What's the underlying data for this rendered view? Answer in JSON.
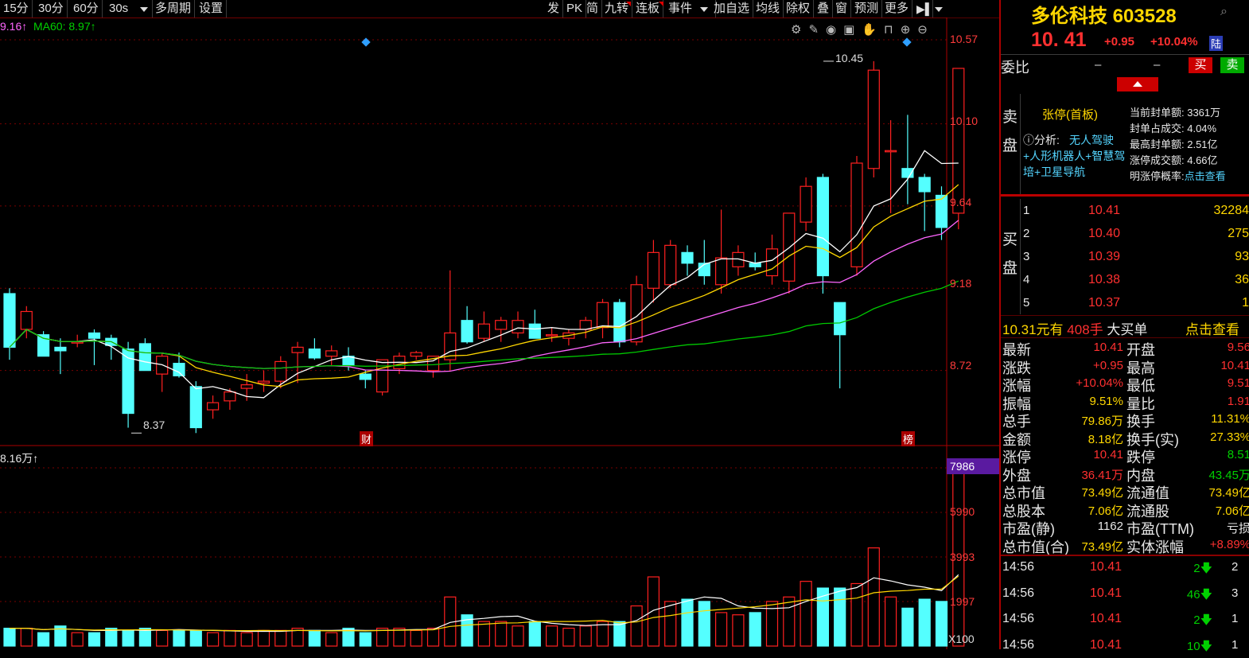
{
  "toolbar": {
    "left": [
      "15分",
      "30分",
      "60分",
      "30s",
      "多周期",
      "设置"
    ],
    "right": [
      "发",
      "PK",
      "简",
      "九转",
      "连板",
      "事件",
      "加自选",
      "均线",
      "除权",
      "叠",
      "窗",
      "预测",
      "更多"
    ]
  },
  "legend": {
    "ma_a": "9.16↑",
    "ma60": "MA60: 8.97↑",
    "vol": "8.16万↑"
  },
  "price_axis": [
    "10.57",
    "10.10",
    "9.64",
    "9.18",
    "8.72"
  ],
  "vol_axis": [
    "7986",
    "5990",
    "3993",
    "1997",
    "X100"
  ],
  "annotations": {
    "high": "10.45",
    "low": "8.37",
    "tag_cai": "财",
    "tag_bang": "榜"
  },
  "colors": {
    "up": "#ff2020",
    "down": "#54ffff",
    "ma5": "#ffffff",
    "ma10": "#ffd700",
    "ma20": "#ff66ff",
    "ma60": "#00c800",
    "panel_bg": "#000000"
  },
  "stock": {
    "name": "多伦科技",
    "code": "603528",
    "price": "10. 41",
    "change": "+0.95",
    "pct": "+10.04%",
    "market": "陆"
  },
  "order": {
    "label": "委比",
    "v1": "–",
    "v2": "–",
    "buy": "买",
    "sell": "卖"
  },
  "limit_info": {
    "title": "张停(首板)",
    "analysis_prefix": "分析:",
    "analysis": "无人驾驶+人形机器人+智慧驾培+卫星导航",
    "lines": [
      "当前封单额: 3361万",
      "封单占成交: 4.04%",
      "最高封单额: 2.51亿",
      "涨停成交额: 4.66亿"
    ],
    "prob_label": "明涨停概率:",
    "prob_link": "点击查看"
  },
  "side_labels": {
    "sell": "卖盘",
    "buy": "买盘"
  },
  "bids": [
    {
      "lvl": "1",
      "price": "10.41",
      "vol": "32284"
    },
    {
      "lvl": "2",
      "price": "10.40",
      "vol": "275"
    },
    {
      "lvl": "3",
      "price": "10.39",
      "vol": "93"
    },
    {
      "lvl": "4",
      "price": "10.38",
      "vol": "36"
    },
    {
      "lvl": "5",
      "price": "10.37",
      "vol": "1"
    }
  ],
  "bigbuy": {
    "price": "10.31元有",
    "qty": "408手",
    "label": "大买单",
    "link": "点击查看"
  },
  "stats": [
    {
      "l": "最新",
      "v": "10.41",
      "vc": "red",
      "l2": "开盘",
      "v2": "9.56",
      "v2c": "red"
    },
    {
      "l": "涨跌",
      "v": "+0.95",
      "vc": "red",
      "l2": "最高",
      "v2": "10.41",
      "v2c": "red"
    },
    {
      "l": "涨幅",
      "v": "+10.04%",
      "vc": "red",
      "l2": "最低",
      "v2": "9.51",
      "v2c": "red"
    },
    {
      "l": "振幅",
      "v": "9.51%",
      "vc": "yellow",
      "l2": "量比",
      "v2": "1.91",
      "v2c": "red"
    },
    {
      "l": "总手",
      "v": "79.86万",
      "vc": "yellow",
      "l2": "换手",
      "v2": "11.31%",
      "v2c": "yellow"
    },
    {
      "l": "金额",
      "v": "8.18亿",
      "vc": "yellow",
      "l2": "换手(实)",
      "v2": "27.33%",
      "v2c": "yellow"
    },
    {
      "l": "涨停",
      "v": "10.41",
      "vc": "red",
      "l2": "跌停",
      "v2": "8.51",
      "v2c": "green"
    },
    {
      "l": "外盘",
      "v": "36.41万",
      "vc": "red",
      "l2": "内盘",
      "v2": "43.45万",
      "v2c": "green"
    },
    {
      "l": "总市值",
      "v": "73.49亿",
      "vc": "yellow",
      "l2": "流通值",
      "v2": "73.49亿",
      "v2c": "yellow"
    },
    {
      "l": "总股本",
      "v": "7.06亿",
      "vc": "yellow",
      "l2": "流通股",
      "v2": "7.06亿",
      "v2c": "yellow"
    },
    {
      "l": "市盈(静)",
      "v": "1162",
      "vc": "white",
      "l2": "市盈(TTM)",
      "v2": "亏损",
      "v2c": "white"
    },
    {
      "l": "总市值(合)",
      "v": "73.49亿",
      "vc": "yellow",
      "l2": "实体涨幅",
      "v2": "+8.89%",
      "v2c": "red"
    }
  ],
  "ticks": [
    {
      "t": "14:56",
      "p": "10.41",
      "v": "2",
      "c": "2"
    },
    {
      "t": "14:56",
      "p": "10.41",
      "v": "46",
      "c": "3"
    },
    {
      "t": "14:56",
      "p": "10.41",
      "v": "2",
      "c": "1"
    },
    {
      "t": "14:56",
      "p": "10.41",
      "v": "10",
      "c": "1"
    }
  ],
  "chart_data": {
    "type": "candlestick",
    "ylim": [
      8.3,
      10.65
    ],
    "candles": [
      [
        9.15,
        9.18,
        8.78,
        8.85
      ],
      [
        8.95,
        9.08,
        8.9,
        9.05
      ],
      [
        8.92,
        8.94,
        8.8,
        8.8
      ],
      [
        8.85,
        8.9,
        8.7,
        8.83
      ],
      [
        8.88,
        8.92,
        8.85,
        8.88
      ],
      [
        8.93,
        8.95,
        8.75,
        8.9
      ],
      [
        8.9,
        8.92,
        8.78,
        8.86
      ],
      [
        8.84,
        8.88,
        8.4,
        8.48
      ],
      [
        8.87,
        8.9,
        8.72,
        8.72
      ],
      [
        8.7,
        8.82,
        8.6,
        8.8
      ],
      [
        8.76,
        8.82,
        8.68,
        8.69
      ],
      [
        8.63,
        8.66,
        8.37,
        8.4
      ],
      [
        8.5,
        8.58,
        8.45,
        8.54
      ],
      [
        8.55,
        8.62,
        8.5,
        8.6
      ],
      [
        8.62,
        8.7,
        8.55,
        8.64
      ],
      [
        8.65,
        8.72,
        8.6,
        8.66
      ],
      [
        8.66,
        8.8,
        8.62,
        8.77
      ],
      [
        8.82,
        8.88,
        8.65,
        8.85
      ],
      [
        8.84,
        8.9,
        8.78,
        8.79
      ],
      [
        8.8,
        8.86,
        8.75,
        8.83
      ],
      [
        8.8,
        8.85,
        8.72,
        8.75
      ],
      [
        8.7,
        8.72,
        8.62,
        8.67
      ],
      [
        8.6,
        8.78,
        8.58,
        8.78
      ],
      [
        8.73,
        8.82,
        8.7,
        8.8
      ],
      [
        8.8,
        8.83,
        8.78,
        8.82
      ],
      [
        8.72,
        8.8,
        8.68,
        8.8
      ],
      [
        8.78,
        9.28,
        8.72,
        8.93
      ],
      [
        9.0,
        9.08,
        8.87,
        8.88
      ],
      [
        8.9,
        9.05,
        8.88,
        8.98
      ],
      [
        8.95,
        9.02,
        8.88,
        9.0
      ],
      [
        8.93,
        9.05,
        8.9,
        9.0
      ],
      [
        8.98,
        9.06,
        8.92,
        8.9
      ],
      [
        8.92,
        8.96,
        8.88,
        8.92
      ],
      [
        8.9,
        8.95,
        8.86,
        8.93
      ],
      [
        8.95,
        9.02,
        8.9,
        9.0
      ],
      [
        8.96,
        9.12,
        8.9,
        9.1
      ],
      [
        9.1,
        9.12,
        8.85,
        8.88
      ],
      [
        8.88,
        9.25,
        8.86,
        9.2
      ],
      [
        9.18,
        9.45,
        9.1,
        9.38
      ],
      [
        9.2,
        9.45,
        9.18,
        9.42
      ],
      [
        9.38,
        9.42,
        9.25,
        9.32
      ],
      [
        9.32,
        9.45,
        9.2,
        9.25
      ],
      [
        9.2,
        9.62,
        9.15,
        9.35
      ],
      [
        9.3,
        9.42,
        9.25,
        9.38
      ],
      [
        9.32,
        9.38,
        9.28,
        9.3
      ],
      [
        9.25,
        9.48,
        9.2,
        9.4
      ],
      [
        9.22,
        9.55,
        9.15,
        9.6
      ],
      [
        9.55,
        9.8,
        9.5,
        9.75
      ],
      [
        9.8,
        9.82,
        9.15,
        9.25
      ],
      [
        9.1,
        9.0,
        8.62,
        8.92
      ],
      [
        9.3,
        9.92,
        9.25,
        9.88
      ],
      [
        9.85,
        10.45,
        9.8,
        10.4
      ],
      [
        9.95,
        10.12,
        9.6,
        9.95
      ],
      [
        9.85,
        10.15,
        9.65,
        9.8
      ],
      [
        9.8,
        9.82,
        9.5,
        9.72
      ],
      [
        9.7,
        9.75,
        9.45,
        9.52
      ],
      [
        9.6,
        10.41,
        9.51,
        10.41
      ]
    ],
    "vol_ylim": [
      0,
      8200
    ],
    "volume_x100": [
      800,
      800,
      600,
      900,
      600,
      600,
      800,
      700,
      800,
      700,
      700,
      700,
      600,
      700,
      600,
      700,
      700,
      800,
      700,
      600,
      800,
      600,
      800,
      800,
      700,
      800,
      2200,
      1400,
      1100,
      1100,
      900,
      1100,
      900,
      800,
      900,
      1100,
      1100,
      1800,
      3100,
      2000,
      2100,
      2000,
      1500,
      1400,
      1500,
      2000,
      2200,
      2900,
      2600,
      2600,
      2800,
      4400,
      2200,
      1700,
      2100,
      2000,
      7986
    ]
  }
}
